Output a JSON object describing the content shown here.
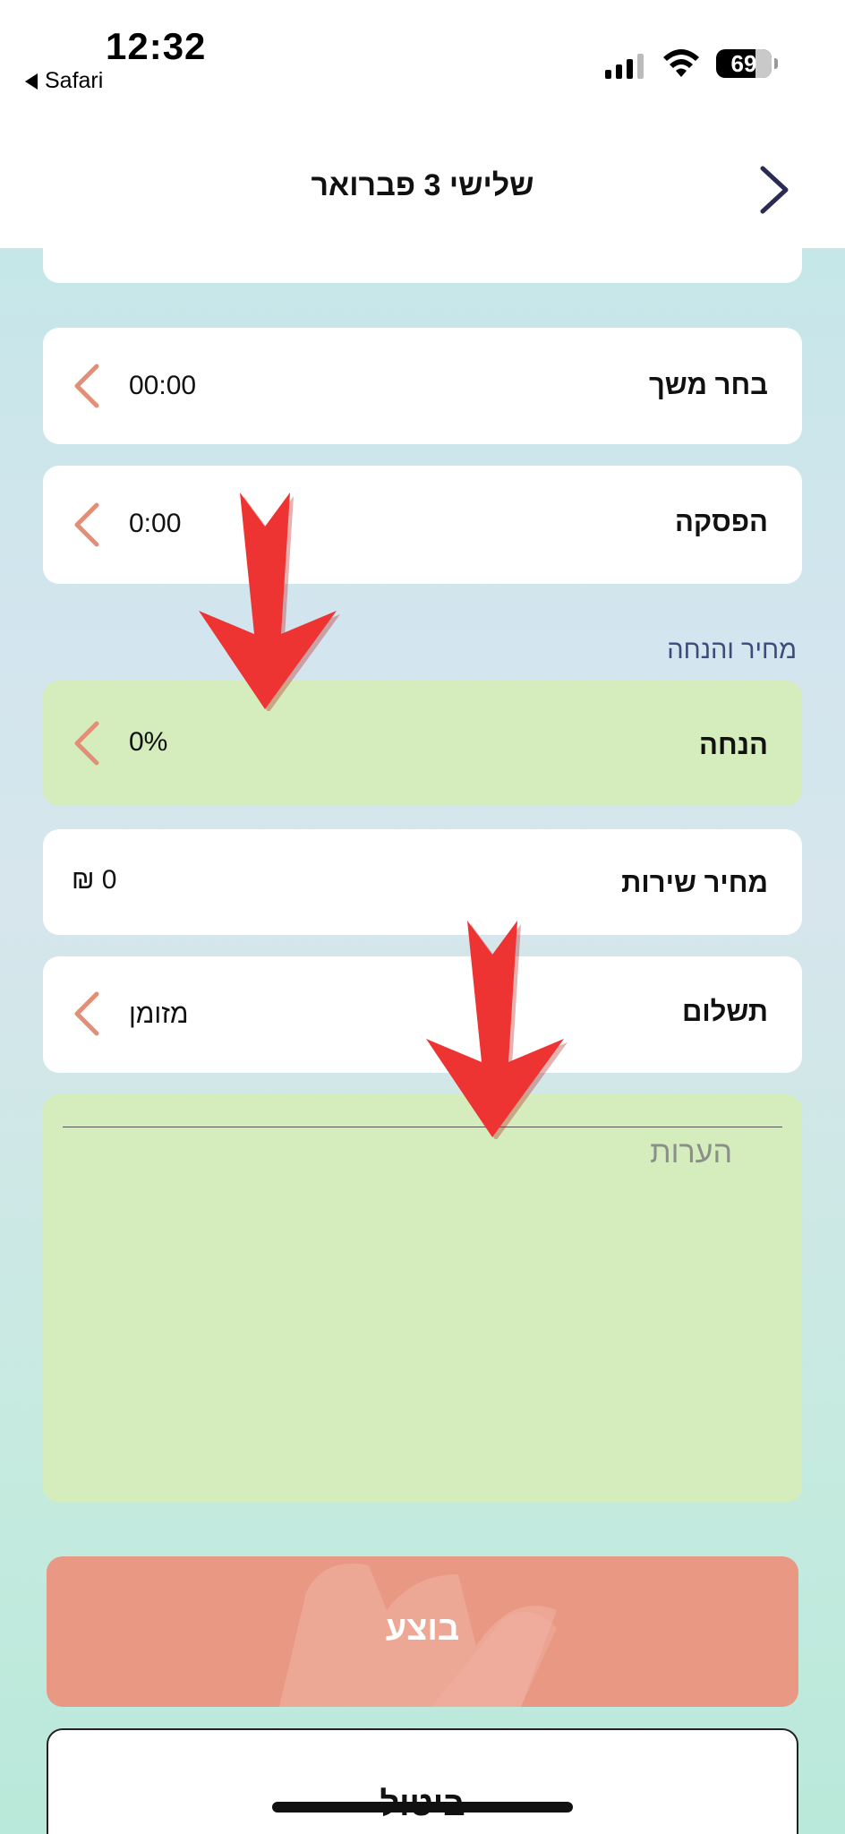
{
  "status_bar": {
    "time": "12:32",
    "back_app": "Safari",
    "battery": "69",
    "signal_icon": "cellular-signal-icon",
    "wifi_icon": "wifi-icon"
  },
  "nav": {
    "title": "שלישי 3 פברואר",
    "back_icon": "chevron-right-icon"
  },
  "rows": {
    "duration": {
      "label": "בחר משך",
      "value": "00:00"
    },
    "break": {
      "label": "הפסקה",
      "value": "0:00"
    },
    "section_price": "מחיר והנחה",
    "discount": {
      "label": "הנחה",
      "value": "0%"
    },
    "service_price": {
      "label": "מחיר שירות",
      "value": "₪ 0"
    },
    "payment": {
      "label": "תשלום",
      "value": "מזומן"
    }
  },
  "notes": {
    "placeholder": "הערות"
  },
  "buttons": {
    "submit": "בוצע",
    "cancel": "ביטול"
  },
  "colors": {
    "accent": "#e89883",
    "highlight_green": "#d5edbc",
    "annotation_arrow": "#ee3333",
    "chevron": "#e38f78"
  }
}
